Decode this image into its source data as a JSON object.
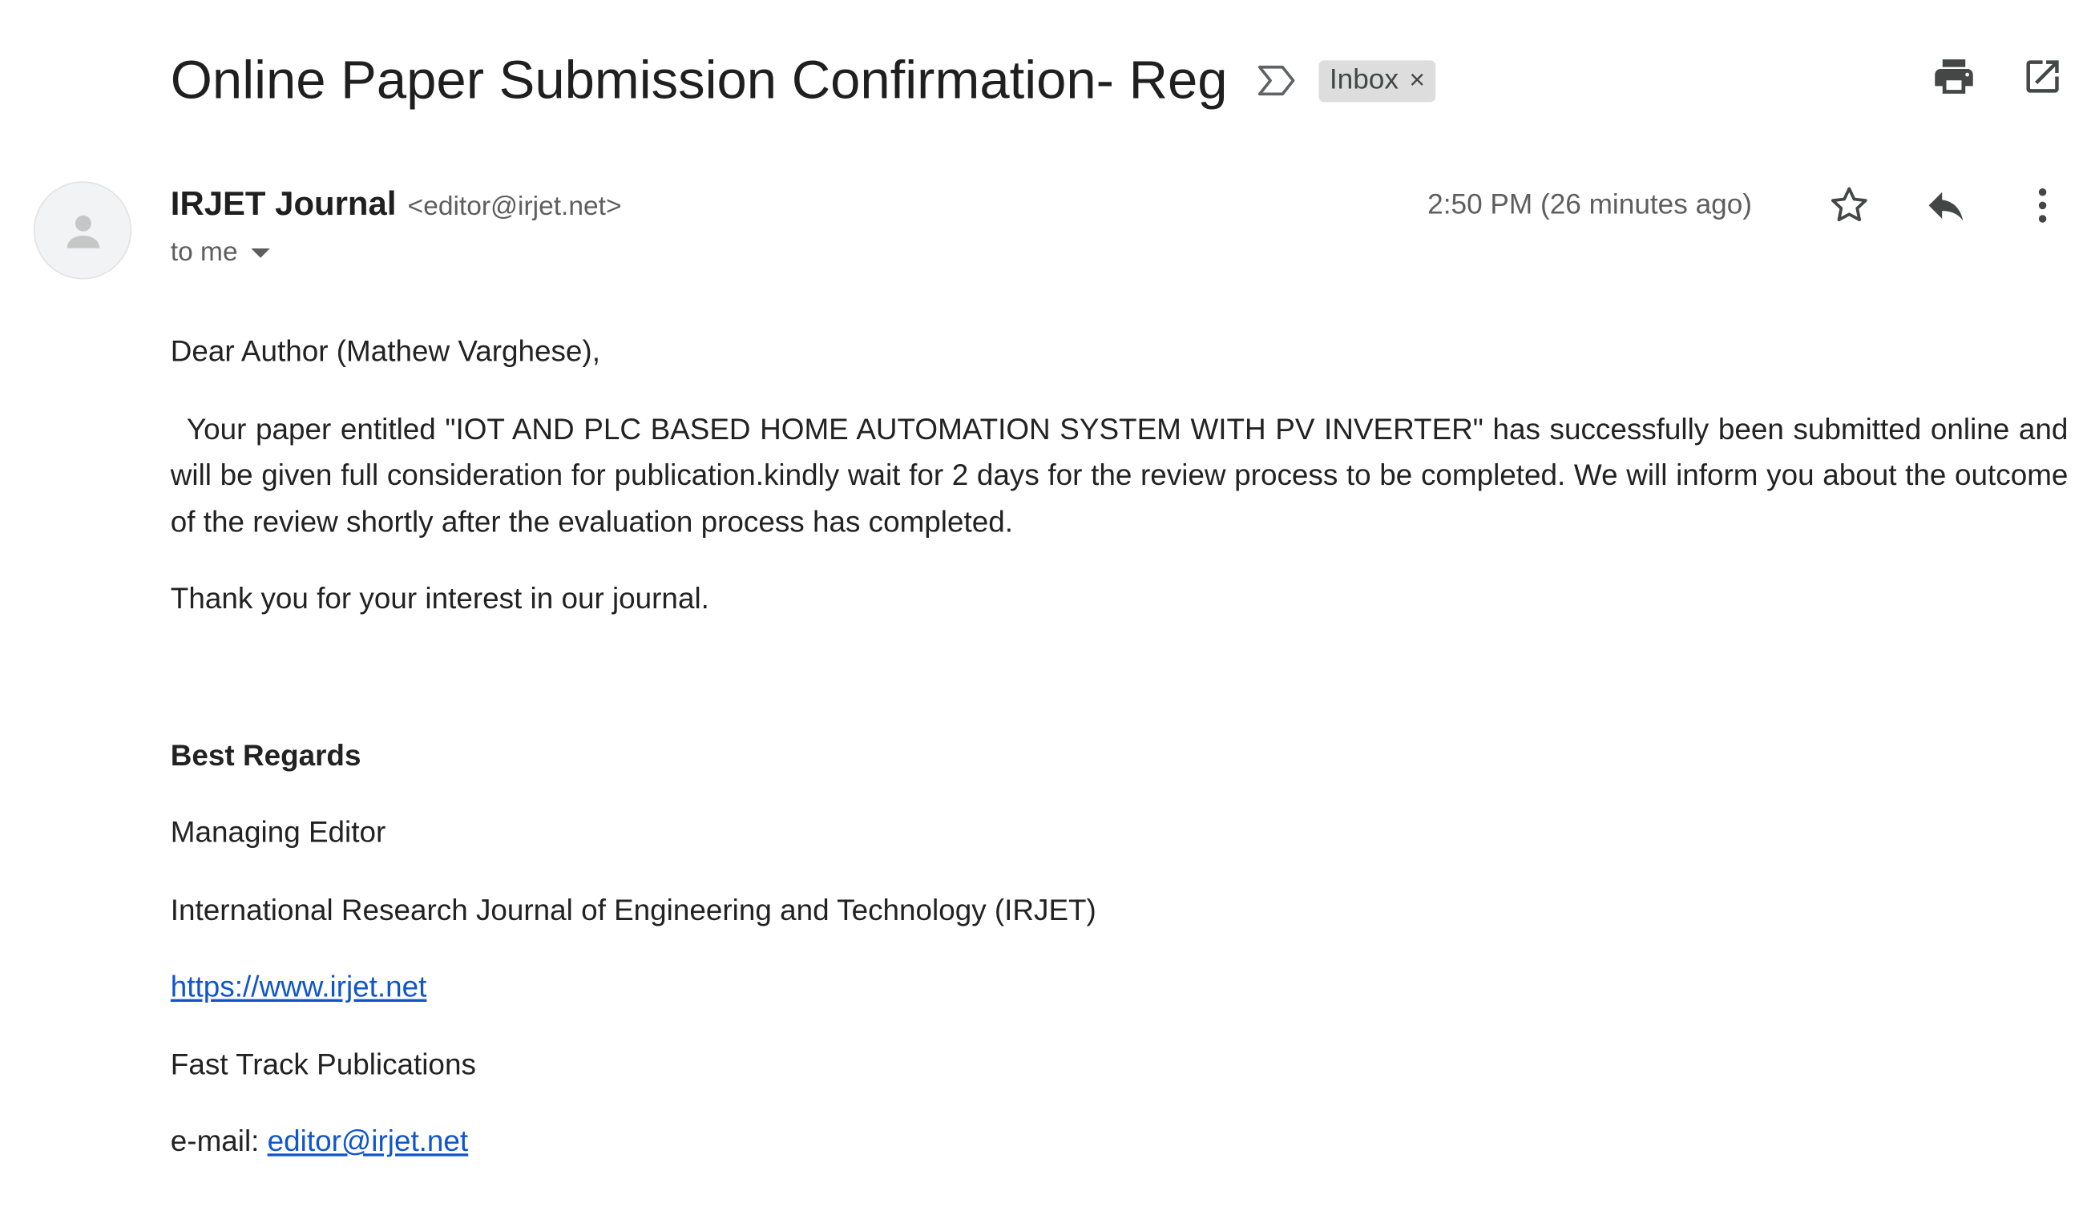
{
  "header": {
    "subject": "Online Paper Submission Confirmation- Reg",
    "label": "Inbox",
    "label_remove": "×",
    "icons": [
      "important-marker-icon",
      "print-icon",
      "open-in-new-window-icon"
    ]
  },
  "sender": {
    "name": "IRJET Journal",
    "email": "<editor@irjet.net>",
    "to": "to me",
    "time": "2:50 PM (26 minutes ago)",
    "icons": [
      "avatar-person-icon",
      "star-icon",
      "reply-icon",
      "more-vert-icon"
    ]
  },
  "body": {
    "greeting": "Dear Author (Mathew Varghese),",
    "paragraph": "Your paper entitled \"IOT AND PLC BASED HOME AUTOMATION SYSTEM WITH PV INVERTER\" has successfully been submitted online and will be given full consideration for publication.kindly wait for 2 days for the review process to be completed. We will inform you about the outcome of the review shortly after the evaluation process has completed.",
    "thanks": "Thank you for your interest in our journal."
  },
  "signature": {
    "regards": "Best Regards",
    "title": "Managing Editor",
    "org": "International Research Journal of Engineering and Technology (IRJET)",
    "website": "https://www.irjet.net",
    "publisher": "Fast Track Publications",
    "email_label": "e-mail: ",
    "email": "editor@irjet.net "
  },
  "colors": {
    "text": "#222222",
    "secondary": "#5e5e5e",
    "link": "#1155cc",
    "chip_bg": "#dddddd"
  }
}
